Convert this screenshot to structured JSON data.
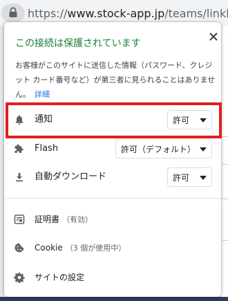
{
  "url_bar": {
    "scheme": "https://",
    "domain": "www.stock-app.jp",
    "path": "/teams/linklive/das"
  },
  "popup": {
    "title": "この接続は保護されています",
    "description": "お客様がこのサイトに送信した情報（パスワード、クレジット カード番号など）が第三者に見られることはありません。",
    "details_link": "詳細",
    "permissions": [
      {
        "icon": "bell-icon",
        "label": "通知",
        "value": "許可"
      },
      {
        "icon": "puzzle-icon",
        "label": "Flash",
        "value": "許可（デフォルト）"
      },
      {
        "icon": "download-icon",
        "label": "自動ダウンロード",
        "value": "許可"
      }
    ],
    "certificate": {
      "label": "証明書",
      "status": "（有効）"
    },
    "cookie": {
      "label": "Cookie",
      "status": "（3 個が使用中）"
    },
    "site_settings": {
      "label": "サイトの設定"
    }
  },
  "colors": {
    "secure_green": "#188038",
    "link_blue": "#1a73e8",
    "highlight_red": "#e0201b"
  }
}
